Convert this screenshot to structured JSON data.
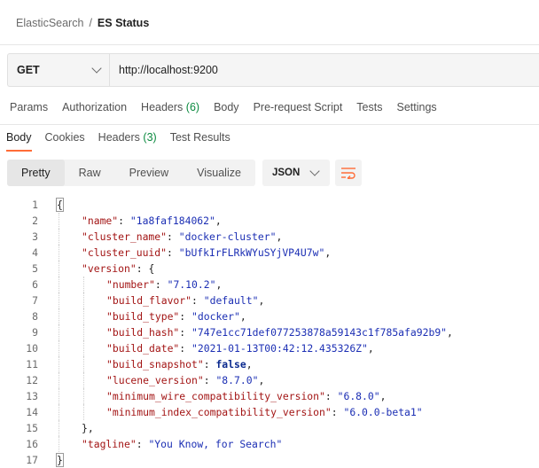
{
  "breadcrumb": {
    "parent": "ElasticSearch",
    "separator": "/",
    "current": "ES Status"
  },
  "request": {
    "method": "GET",
    "url": "http://localhost:9200"
  },
  "request_tabs": [
    {
      "label": "Params"
    },
    {
      "label": "Authorization"
    },
    {
      "label": "Headers",
      "count": "(6)"
    },
    {
      "label": "Body"
    },
    {
      "label": "Pre-request Script"
    },
    {
      "label": "Tests"
    },
    {
      "label": "Settings"
    }
  ],
  "response_tabs": [
    {
      "label": "Body",
      "active": true
    },
    {
      "label": "Cookies"
    },
    {
      "label": "Headers",
      "count": "(3)"
    },
    {
      "label": "Test Results"
    }
  ],
  "view_modes": [
    "Pretty",
    "Raw",
    "Preview",
    "Visualize"
  ],
  "active_view": "Pretty",
  "format": "JSON",
  "colors": {
    "accent": "#ff6c37",
    "count": "#0b8a3f",
    "key": "#a31515",
    "string": "#1c2fb4",
    "boolean": "#0b2a8f"
  },
  "code_lines": [
    {
      "n": "1",
      "indent": 0,
      "tokens": [
        [
          "p",
          "{"
        ]
      ]
    },
    {
      "n": "2",
      "indent": 1,
      "tokens": [
        [
          "k",
          "\"name\""
        ],
        [
          "p",
          ": "
        ],
        [
          "s",
          "\"1a8faf184062\""
        ],
        [
          "p",
          ","
        ]
      ]
    },
    {
      "n": "3",
      "indent": 1,
      "tokens": [
        [
          "k",
          "\"cluster_name\""
        ],
        [
          "p",
          ": "
        ],
        [
          "s",
          "\"docker-cluster\""
        ],
        [
          "p",
          ","
        ]
      ]
    },
    {
      "n": "4",
      "indent": 1,
      "tokens": [
        [
          "k",
          "\"cluster_uuid\""
        ],
        [
          "p",
          ": "
        ],
        [
          "s",
          "\"bUfkIrFLRkWYuSYjVP4U7w\""
        ],
        [
          "p",
          ","
        ]
      ]
    },
    {
      "n": "5",
      "indent": 1,
      "tokens": [
        [
          "k",
          "\"version\""
        ],
        [
          "p",
          ": {"
        ]
      ]
    },
    {
      "n": "6",
      "indent": 2,
      "tokens": [
        [
          "k",
          "\"number\""
        ],
        [
          "p",
          ": "
        ],
        [
          "s",
          "\"7.10.2\""
        ],
        [
          "p",
          ","
        ]
      ]
    },
    {
      "n": "7",
      "indent": 2,
      "tokens": [
        [
          "k",
          "\"build_flavor\""
        ],
        [
          "p",
          ": "
        ],
        [
          "s",
          "\"default\""
        ],
        [
          "p",
          ","
        ]
      ]
    },
    {
      "n": "8",
      "indent": 2,
      "tokens": [
        [
          "k",
          "\"build_type\""
        ],
        [
          "p",
          ": "
        ],
        [
          "s",
          "\"docker\""
        ],
        [
          "p",
          ","
        ]
      ]
    },
    {
      "n": "9",
      "indent": 2,
      "tokens": [
        [
          "k",
          "\"build_hash\""
        ],
        [
          "p",
          ": "
        ],
        [
          "s",
          "\"747e1cc71def077253878a59143c1f785afa92b9\""
        ],
        [
          "p",
          ","
        ]
      ]
    },
    {
      "n": "10",
      "indent": 2,
      "tokens": [
        [
          "k",
          "\"build_date\""
        ],
        [
          "p",
          ": "
        ],
        [
          "s",
          "\"2021-01-13T00:42:12.435326Z\""
        ],
        [
          "p",
          ","
        ]
      ]
    },
    {
      "n": "11",
      "indent": 2,
      "tokens": [
        [
          "k",
          "\"build_snapshot\""
        ],
        [
          "p",
          ": "
        ],
        [
          "b",
          "false"
        ],
        [
          "p",
          ","
        ]
      ]
    },
    {
      "n": "12",
      "indent": 2,
      "tokens": [
        [
          "k",
          "\"lucene_version\""
        ],
        [
          "p",
          ": "
        ],
        [
          "s",
          "\"8.7.0\""
        ],
        [
          "p",
          ","
        ]
      ]
    },
    {
      "n": "13",
      "indent": 2,
      "tokens": [
        [
          "k",
          "\"minimum_wire_compatibility_version\""
        ],
        [
          "p",
          ": "
        ],
        [
          "s",
          "\"6.8.0\""
        ],
        [
          "p",
          ","
        ]
      ]
    },
    {
      "n": "14",
      "indent": 2,
      "tokens": [
        [
          "k",
          "\"minimum_index_compatibility_version\""
        ],
        [
          "p",
          ": "
        ],
        [
          "s",
          "\"6.0.0-beta1\""
        ]
      ]
    },
    {
      "n": "15",
      "indent": 1,
      "tokens": [
        [
          "p",
          "},"
        ]
      ]
    },
    {
      "n": "16",
      "indent": 1,
      "tokens": [
        [
          "k",
          "\"tagline\""
        ],
        [
          "p",
          ": "
        ],
        [
          "s",
          "\"You Know, for Search\""
        ]
      ]
    },
    {
      "n": "17",
      "indent": 0,
      "tokens": [
        [
          "p",
          "}"
        ]
      ]
    }
  ]
}
